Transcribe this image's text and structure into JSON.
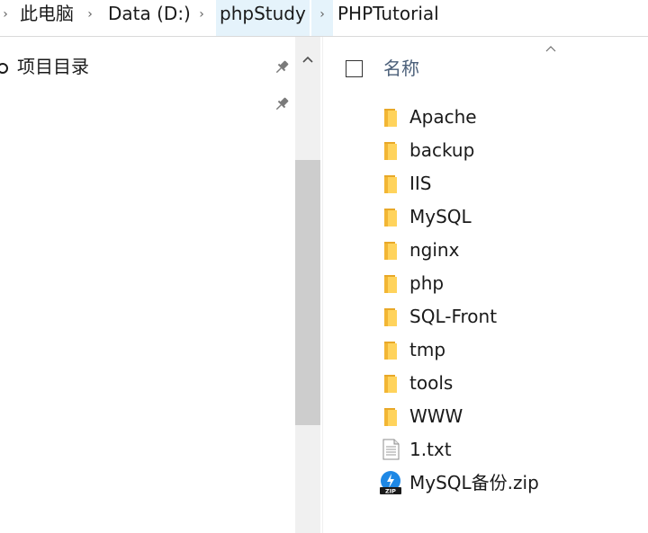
{
  "breadcrumb": {
    "items": [
      {
        "label": "此电脑"
      },
      {
        "label": "Data (D:)"
      },
      {
        "label": "phpStudy"
      },
      {
        "label": "PHPTutorial"
      }
    ]
  },
  "navigation": {
    "quick_item": {
      "label": "项目目录",
      "icon": "circle-icon",
      "pinned": true
    },
    "second_pin_icon": "pin-icon"
  },
  "file_list": {
    "column_header": {
      "name_label": "名称",
      "sort": "ascending"
    },
    "items": [
      {
        "name": "Apache",
        "type": "folder"
      },
      {
        "name": "backup",
        "type": "folder"
      },
      {
        "name": "IIS",
        "type": "folder"
      },
      {
        "name": "MySQL",
        "type": "folder"
      },
      {
        "name": "nginx",
        "type": "folder"
      },
      {
        "name": "php",
        "type": "folder"
      },
      {
        "name": "SQL-Front",
        "type": "folder"
      },
      {
        "name": "tmp",
        "type": "folder"
      },
      {
        "name": "tools",
        "type": "folder"
      },
      {
        "name": "WWW",
        "type": "folder"
      },
      {
        "name": "1.txt",
        "type": "text-file"
      },
      {
        "name": "MySQL备份.zip",
        "type": "zip-file"
      }
    ],
    "zip_badge": "ZIP"
  },
  "colors": {
    "folder": "#ffc83d",
    "folder_dark": "#e8a828",
    "breadcrumb_highlight": "#e5f3fb",
    "header_text": "#4c607a",
    "zip_blue": "#1e88e5"
  }
}
